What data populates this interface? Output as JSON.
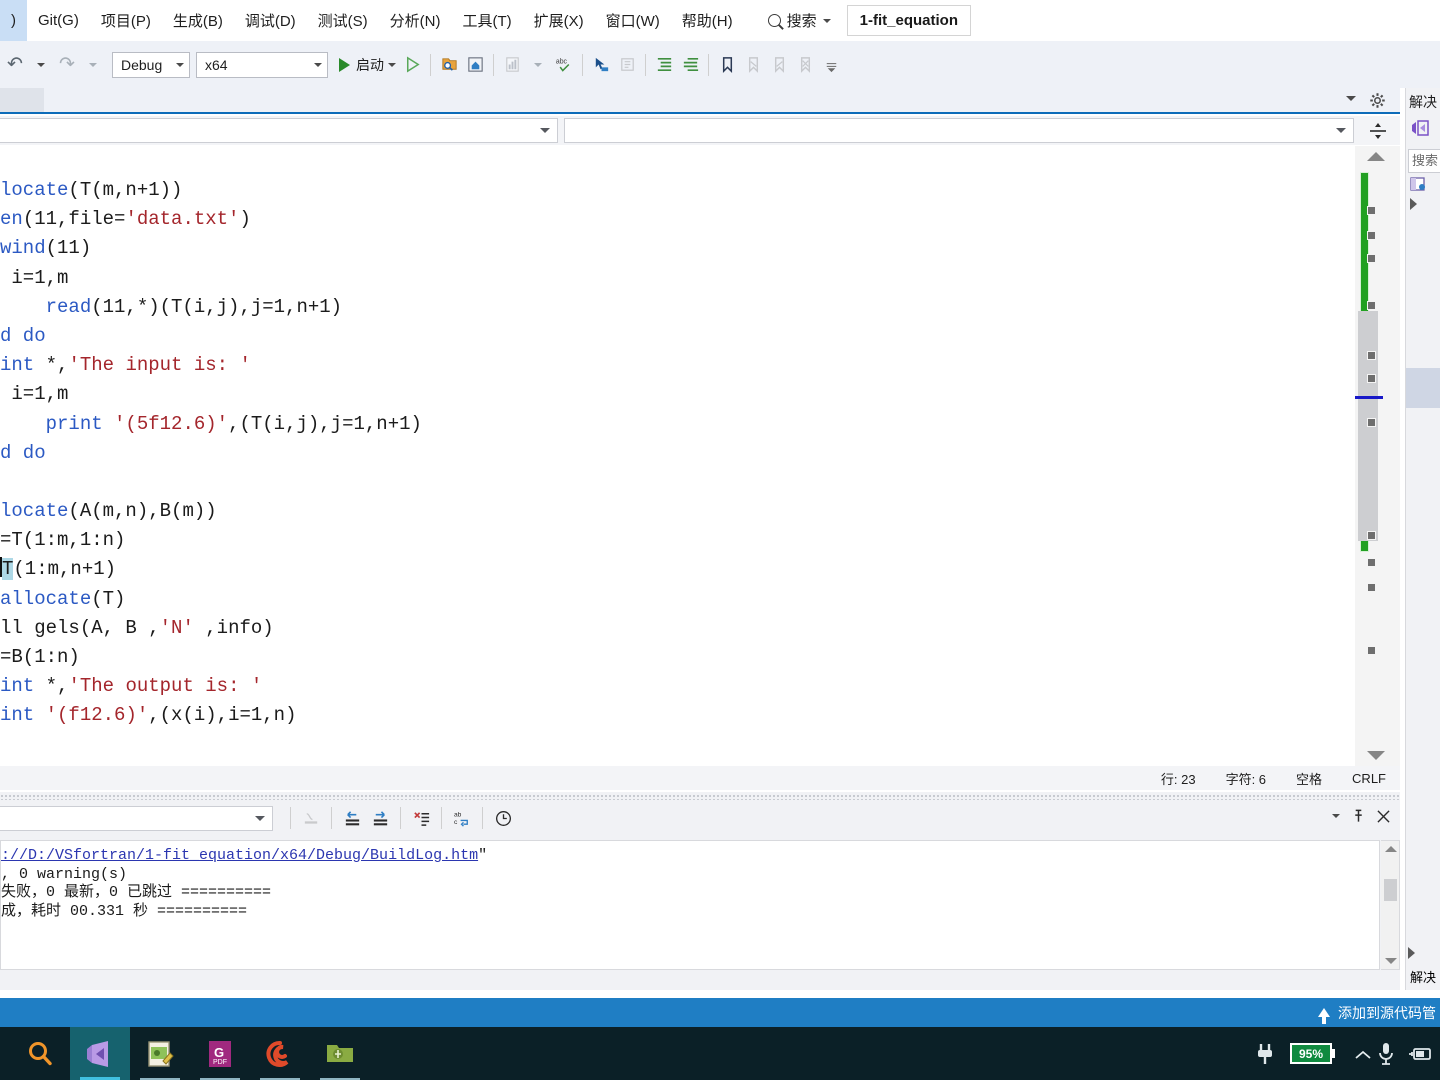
{
  "menu": {
    "items": [
      {
        "label": ")",
        "name": "menu-clipped"
      },
      {
        "label": "Git(G)",
        "name": "menu-git"
      },
      {
        "label": "项目(P)",
        "name": "menu-project"
      },
      {
        "label": "生成(B)",
        "name": "menu-build"
      },
      {
        "label": "调试(D)",
        "name": "menu-debug"
      },
      {
        "label": "测试(S)",
        "name": "menu-test"
      },
      {
        "label": "分析(N)",
        "name": "menu-analyze"
      },
      {
        "label": "工具(T)",
        "name": "menu-tools"
      },
      {
        "label": "扩展(X)",
        "name": "menu-extensions"
      },
      {
        "label": "窗口(W)",
        "name": "menu-window"
      },
      {
        "label": "帮助(H)",
        "name": "menu-help"
      }
    ],
    "search_label": "搜索",
    "search_icon": "search-icon",
    "project_tab": "1-fit_equation"
  },
  "toolbar": {
    "undo_icon": "undo-icon",
    "redo_icon": "redo-icon",
    "configuration": "Debug",
    "platform": "x64",
    "start_label": "启动",
    "start_icon": "play-icon",
    "start_no_debug_icon": "play-outline-icon",
    "icons": [
      "find-in-files-icon",
      "navigate-home-icon",
      "chart-icon",
      "spellcheck-icon",
      "goto-definition-icon",
      "comment-icon",
      "indent-icon",
      "outdent-icon",
      "bookmark-icon",
      "bookmark-next-icon",
      "bookmark-prev-icon",
      "bookmark-clear-icon",
      "overflow-icon"
    ]
  },
  "editor_top": {
    "caret_icon": "chevron-down-icon",
    "gear_icon": "gear-icon"
  },
  "nav_bar": {
    "scope_value": "",
    "member_value": "",
    "caret_icon": "chevron-down-icon",
    "split_icon": "split-view-icon"
  },
  "code": {
    "language": "Fortran",
    "note": "view is horizontally scrolled; left columns are clipped",
    "lines": [
      [
        {
          "t": "locate",
          "c": "kw"
        },
        {
          "t": "(T(m,n+1))",
          "c": "pl"
        }
      ],
      [
        {
          "t": "en",
          "c": "kw"
        },
        {
          "t": "(11,file=",
          "c": "pl"
        },
        {
          "t": "'data.txt'",
          "c": "str"
        },
        {
          "t": ")",
          "c": "pl"
        }
      ],
      [
        {
          "t": "wind",
          "c": "kw"
        },
        {
          "t": "(11)",
          "c": "pl"
        }
      ],
      [
        {
          "t": " i=1,m",
          "c": "pl"
        }
      ],
      [
        {
          "t": "    ",
          "c": "pl"
        },
        {
          "t": "read",
          "c": "kw"
        },
        {
          "t": "(11,*)(T(i,j),j=1,n+1)",
          "c": "pl"
        }
      ],
      [
        {
          "t": "d do",
          "c": "kw"
        }
      ],
      [
        {
          "t": "int",
          "c": "kw"
        },
        {
          "t": " *,",
          "c": "pl"
        },
        {
          "t": "'The input is: '",
          "c": "str"
        }
      ],
      [
        {
          "t": " i=1,m",
          "c": "pl"
        }
      ],
      [
        {
          "t": "    ",
          "c": "pl"
        },
        {
          "t": "print",
          "c": "kw"
        },
        {
          "t": " ",
          "c": "pl"
        },
        {
          "t": "'(5f12.6)'",
          "c": "str"
        },
        {
          "t": ",(T(i,j),j=1,n+1)",
          "c": "pl"
        }
      ],
      [
        {
          "t": "d do",
          "c": "kw"
        }
      ],
      [
        {
          "t": "",
          "c": "pl"
        }
      ],
      [
        {
          "t": "locate",
          "c": "kw"
        },
        {
          "t": "(A(m,n),B(m))",
          "c": "pl"
        }
      ],
      [
        {
          "t": "=T(1:m,1:n)",
          "c": "pl"
        }
      ],
      [
        {
          "t": "T",
          "c": "selT"
        },
        {
          "t": "(1:m,n+1)",
          "c": "pl"
        }
      ],
      [
        {
          "t": "allocate",
          "c": "kw"
        },
        {
          "t": "(T)",
          "c": "pl"
        }
      ],
      [
        {
          "t": "ll gels(A, B ,",
          "c": "pl"
        },
        {
          "t": "'N'",
          "c": "str"
        },
        {
          "t": " ,info)",
          "c": "pl"
        }
      ],
      [
        {
          "t": "=B(1:n)",
          "c": "pl"
        }
      ],
      [
        {
          "t": "int",
          "c": "kw"
        },
        {
          "t": " *,",
          "c": "pl"
        },
        {
          "t": "'The output is: '",
          "c": "str"
        }
      ],
      [
        {
          "t": "int",
          "c": "kw"
        },
        {
          "t": " ",
          "c": "pl"
        },
        {
          "t": "'(f12.6)'",
          "c": "str"
        },
        {
          "t": ",(x(i),i=1,n)",
          "c": "pl"
        }
      ]
    ]
  },
  "editor_status": {
    "line_label": "行: 23",
    "column_label": "字符: 6",
    "spaces_label": "空格",
    "eol_label": "CRLF"
  },
  "output_panel": {
    "selected_source": "",
    "caret_icon": "chevron-down-icon",
    "tool_icons": [
      "clear-all-icon",
      "go-to-previous-icon",
      "go-to-next-icon",
      "clear-output-icon",
      "toggle-wordwrap-icon",
      "show-timestamps-icon"
    ],
    "menu_icon": "chevron-down-icon",
    "pin_icon": "pin-icon",
    "close_icon": "close-icon",
    "lines": [
      {
        "text": "://D:/VSfortran/1-fit_equation/x64/Debug/BuildLog.htm",
        "link": true,
        "suffix": "\""
      },
      {
        "text": ", 0 warning(s)",
        "link": false
      },
      {
        "text": "失败，0 最新，0 已跳过 ==========",
        "link": false
      },
      {
        "text": "成，耗时 00.331 秒 ==========",
        "link": false
      }
    ]
  },
  "solution_explorer": {
    "title": "解决",
    "logo_icon": "visual-studio-icon",
    "search_placeholder": "搜索",
    "node_icon": "solution-node-icon",
    "expander_icon": "triangle-right-icon",
    "bottom_title": "解决",
    "back_icon": "triangle-left-icon"
  },
  "vs_status": {
    "source_control_label": "添加到源代码管",
    "up_icon": "upload-icon",
    "background": "#1f7ec4"
  },
  "taskbar": {
    "apps": [
      {
        "name": "taskbar-search-icon",
        "label": "search",
        "active": false
      },
      {
        "name": "taskbar-visual-studio-icon",
        "label": "Visual Studio",
        "active": true
      },
      {
        "name": "taskbar-notepad-icon",
        "label": "editor",
        "active": false
      },
      {
        "name": "taskbar-pdf-icon",
        "label": "PDF",
        "active": false
      },
      {
        "name": "taskbar-origin-icon",
        "label": "Origin",
        "active": false
      },
      {
        "name": "taskbar-folder-icon",
        "label": "folder",
        "active": false
      }
    ],
    "tray": {
      "plug_icon": "power-plug-icon",
      "battery_percent": "95%",
      "battery_icon": "battery-icon",
      "chevron_icon": "chevron-up-icon",
      "mic_icon": "microphone-icon",
      "charge_icon": "battery-charging-icon"
    }
  }
}
